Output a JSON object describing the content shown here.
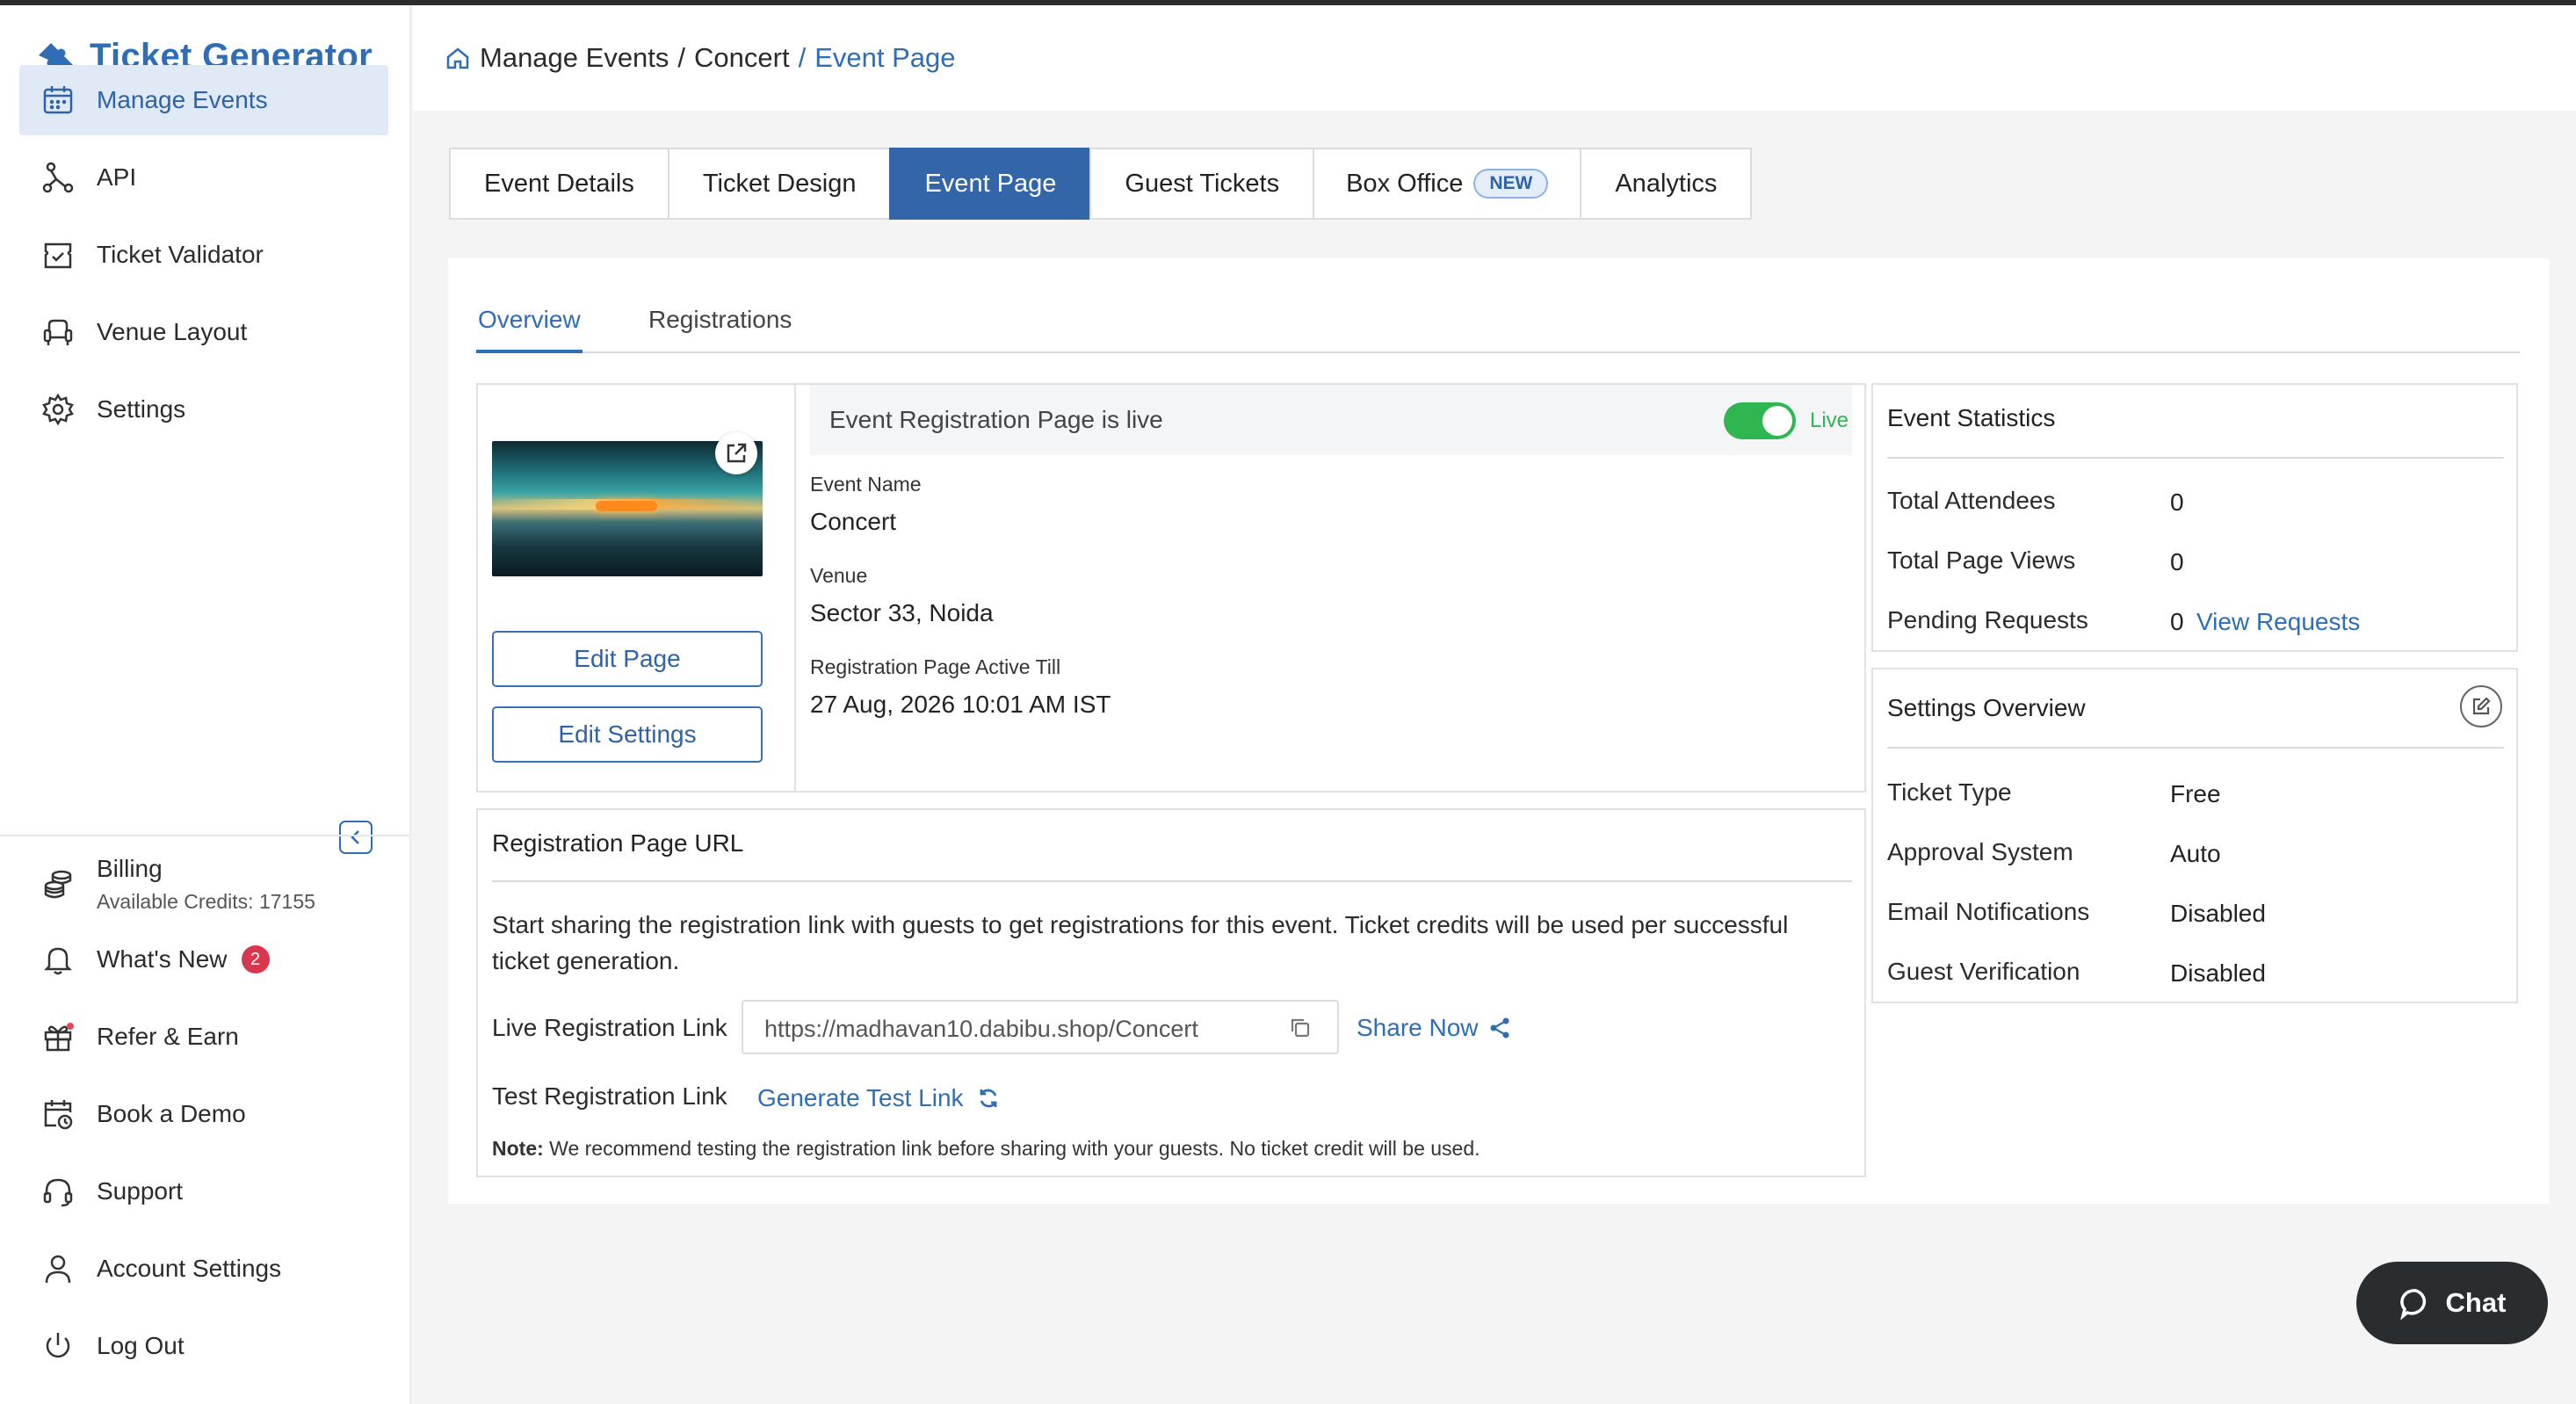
{
  "app": {
    "name": "Ticket Generator",
    "brand_color": "#2f6db5"
  },
  "sidebar": {
    "items": [
      {
        "label": "Manage Events",
        "icon": "calendar-icon"
      },
      {
        "label": "API",
        "icon": "api-icon"
      },
      {
        "label": "Ticket Validator",
        "icon": "ticket-validator-icon"
      },
      {
        "label": "Venue Layout",
        "icon": "venue-seat-icon"
      },
      {
        "label": "Settings",
        "icon": "gear-icon"
      }
    ],
    "bottom": {
      "billing": {
        "label": "Billing",
        "credits": "Available Credits: 17155"
      },
      "whats_new": {
        "label": "What's New",
        "badge": "2"
      },
      "refer": {
        "label": "Refer & Earn"
      },
      "demo": {
        "label": "Book a Demo"
      },
      "support": {
        "label": "Support"
      },
      "account": {
        "label": "Account Settings"
      },
      "logout": {
        "label": "Log Out"
      }
    }
  },
  "breadcrumb": {
    "part1": "Manage Events",
    "sep1": "/",
    "part2": "Concert",
    "sep2": "/",
    "current": "Event Page"
  },
  "tabs": [
    {
      "label": "Event Details"
    },
    {
      "label": "Ticket Design"
    },
    {
      "label": "Event Page"
    },
    {
      "label": "Guest Tickets"
    },
    {
      "label": "Box Office",
      "pill": "NEW"
    },
    {
      "label": "Analytics"
    }
  ],
  "subtabs": {
    "overview": "Overview",
    "registrations": "Registrations"
  },
  "event_card": {
    "status_text": "Event Registration Page is live",
    "toggle_label": "Live",
    "name_label": "Event Name",
    "name_value": "Concert",
    "venue_label": "Venue",
    "venue_value": "Sector 33, Noida",
    "active_till_label": "Registration Page Active Till",
    "active_till_value": "27 Aug, 2026 10:01 AM IST",
    "edit_page": "Edit Page",
    "edit_settings": "Edit Settings"
  },
  "registration_url": {
    "title": "Registration Page URL",
    "description": "Start sharing the registration link with guests to get registrations for this event. Ticket credits will be used per successful",
    "description2": "ticket generation.",
    "live_label": "Live Registration Link",
    "live_url": "https://madhavan10.dabibu.shop/Concert",
    "share_now": "Share Now",
    "test_label": "Test Registration Link",
    "generate_test": "Generate Test Link",
    "note_bold": "Note:",
    "note_text": "We recommend testing the registration link before sharing with your guests. No ticket credit will be used."
  },
  "event_statistics": {
    "title": "Event Statistics",
    "total_attendees_label": "Total Attendees",
    "total_attendees_value": "0",
    "page_views_label": "Total Page Views",
    "page_views_value": "0",
    "pending_label": "Pending Requests",
    "pending_value": "0",
    "view_requests": "View Requests"
  },
  "settings_overview": {
    "title": "Settings Overview",
    "ticket_type_label": "Ticket Type",
    "ticket_type_value": "Free",
    "approval_label": "Approval System",
    "approval_value": "Auto",
    "email_label": "Email Notifications",
    "email_value": "Disabled",
    "guest_verif_label": "Guest Verification",
    "guest_verif_value": "Disabled"
  },
  "chat": {
    "label": "Chat"
  }
}
